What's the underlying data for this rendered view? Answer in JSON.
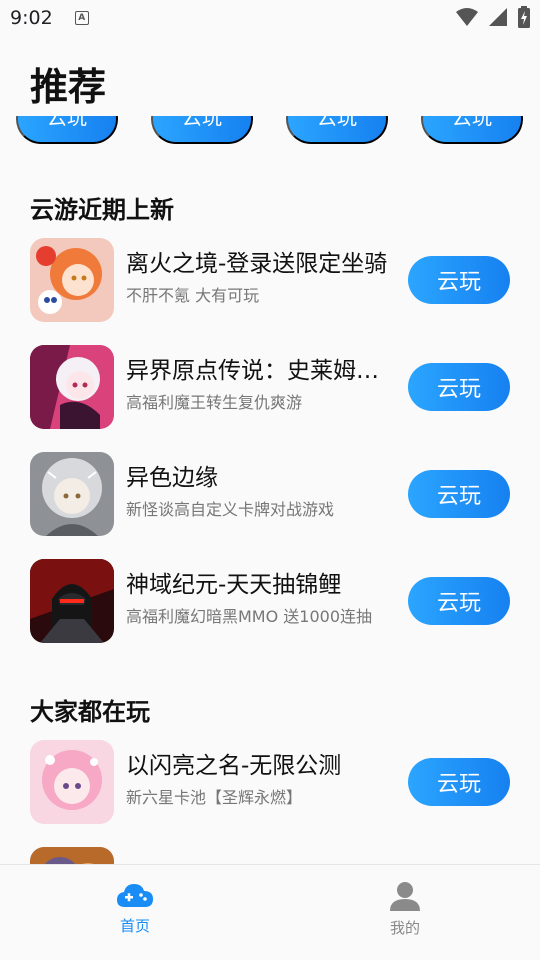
{
  "status_bar": {
    "time": "9:02",
    "notification_glyph": "A"
  },
  "header": {
    "title": "推荐"
  },
  "peek_buttons": [
    {
      "label": "云玩"
    },
    {
      "label": "云玩"
    },
    {
      "label": "云玩"
    },
    {
      "label": "云玩"
    }
  ],
  "sections": {
    "recent": {
      "title": "云游近期上新",
      "games": [
        {
          "name": "离火之境-登录送限定坐骑",
          "desc": "不肝不氪 大有可玩",
          "button": "云玩"
        },
        {
          "name": "异界原点传说：史莱姆英雄",
          "desc": "高福利魔王转生复仇爽游",
          "button": "云玩"
        },
        {
          "name": "异色边缘",
          "desc": "新怪谈高自定义卡牌对战游戏",
          "button": "云玩"
        },
        {
          "name": "神域纪元-天天抽锦鲤",
          "desc": "高福利魔幻暗黑MMO 送1000连抽",
          "button": "云玩"
        }
      ]
    },
    "popular": {
      "title": "大家都在玩",
      "games": [
        {
          "name": "以闪亮之名-无限公测",
          "desc": "新六星卡池【圣辉永燃】",
          "button": "云玩"
        }
      ]
    }
  },
  "bottom_nav": {
    "home": {
      "label": "首页",
      "icon": "cloud-gamepad-icon",
      "active": true
    },
    "mine": {
      "label": "我的",
      "icon": "person-icon",
      "active": false
    }
  },
  "colors": {
    "accent": "#1a8cf5",
    "nav_inactive": "#8a8a8a"
  }
}
